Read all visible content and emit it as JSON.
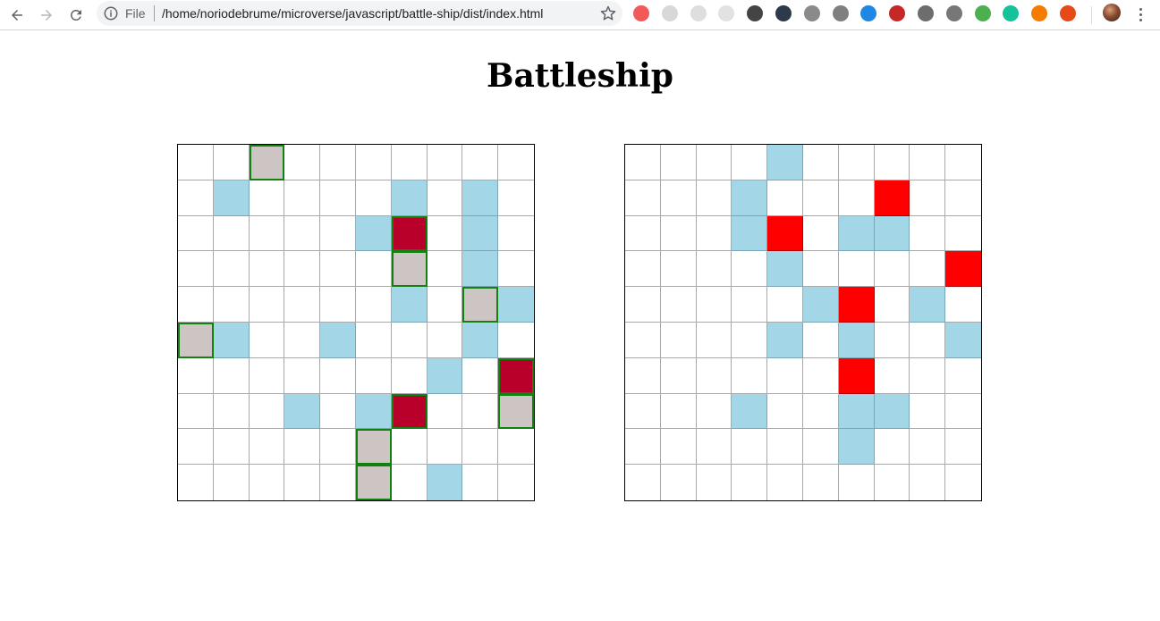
{
  "browser": {
    "file_label": "File",
    "url": "/home/noriodebrume/microverse/javascript/battle-ship/dist/index.html",
    "extensions": [
      {
        "name": "cast-icon",
        "color": "#f25a5a"
      },
      {
        "name": "ext-gray-1-icon",
        "color": "#d8d8d8"
      },
      {
        "name": "ext-gray-2-icon",
        "color": "#dedede"
      },
      {
        "name": "ext-gray-3-icon",
        "color": "#e2e2e2"
      },
      {
        "name": "ext-dark-1-icon",
        "color": "#444444"
      },
      {
        "name": "ext-ninja-icon",
        "color": "#2d3a4a"
      },
      {
        "name": "ext-book-icon",
        "color": "#8a8a8a"
      },
      {
        "name": "ext-gray-4-icon",
        "color": "#7f7f7f"
      },
      {
        "name": "ext-blue-k-icon",
        "color": "#1e88e5"
      },
      {
        "name": "ext-red-hat-icon",
        "color": "#c62828"
      },
      {
        "name": "ext-badge-icon",
        "color": "#6d6d6d"
      },
      {
        "name": "ext-bug-icon",
        "color": "#777777"
      },
      {
        "name": "ext-rainbow-icon",
        "color": "#4caf50"
      },
      {
        "name": "grammarly-icon",
        "color": "#15c39a"
      },
      {
        "name": "ext-orange-ring-icon",
        "color": "#f57c00"
      },
      {
        "name": "ext-orange-icon",
        "color": "#e64a19"
      }
    ]
  },
  "page": {
    "title": "Battleship"
  },
  "colors": {
    "water": "#a3d6e6",
    "ship": "#cdc4c4",
    "ship_hit": "#b8002a",
    "hit": "#ff0000",
    "ship_outline": "#118211"
  },
  "boards": {
    "player": {
      "rows": [
        "..S.......",
        ".W....W.W.",
        ".....WX.W.",
        "......S.W.",
        "......W.SW",
        "SW..W...W.",
        ".......W.X",
        "...W.WX..S",
        ".....S....",
        ".....S.W.."
      ]
    },
    "opponent": {
      "rows": [
        "....W.....",
        "...W...H..",
        "...WH.WW..",
        "....W....H",
        ".....WH.W.",
        "....W.W..W",
        "......H...",
        "...W..WW..",
        "......W...",
        ".........."
      ]
    }
  }
}
